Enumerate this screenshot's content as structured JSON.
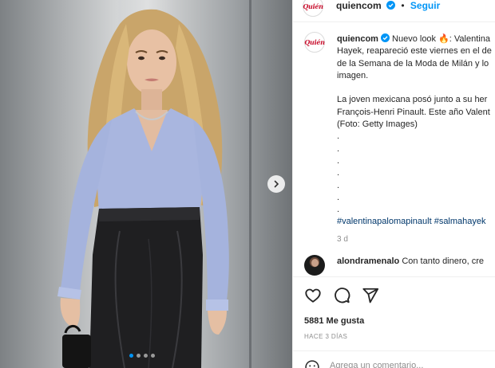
{
  "post": {
    "username": "quiencom",
    "follow_label": "Seguir",
    "separator": "•",
    "logo_text": "Quién"
  },
  "caption": {
    "username": "quiencom",
    "lines": [
      "Nuevo look 🔥: Valentina",
      "Hayek, reapareció este viernes en el de",
      "de la Semana de la Moda de Milán y lo",
      "imagen."
    ],
    "lines2": [
      "La joven mexicana posó junto a su her",
      "François-Henri Pinault. Este año Valent",
      "(Foto: Getty Images)"
    ],
    "dots": [
      ".",
      ".",
      ".",
      ".",
      ".",
      ".",
      "."
    ],
    "hashtags": "#valentinapalomapinault #salmahayek",
    "time": "3 d"
  },
  "comment": {
    "username": "alondramenalo",
    "text": "Con tanto dinero, cre"
  },
  "stats": {
    "likes": "5881 Me gusta",
    "ago": "HACE 3 DÍAS"
  },
  "add_comment": {
    "placeholder": "Agrega un comentario..."
  },
  "colors": {
    "accent": "#0095f6",
    "brand": "#c8102e",
    "hashtag": "#00376b"
  }
}
